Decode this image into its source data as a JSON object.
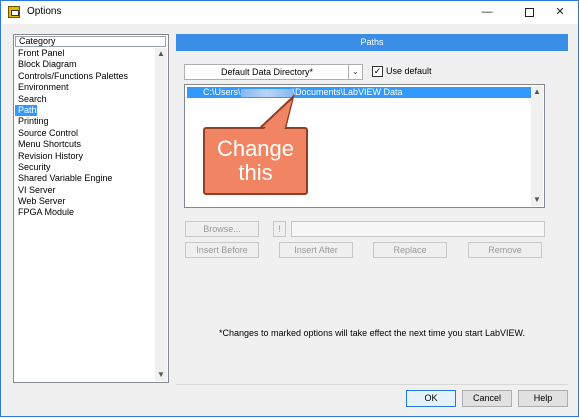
{
  "window": {
    "title": "Options",
    "minimize": "—",
    "maximize": "",
    "close": "✕"
  },
  "category": {
    "header": "Category",
    "items": [
      "Front Panel",
      "Block Diagram",
      "Controls/Functions Palettes",
      "Environment",
      "Search",
      "Paths",
      "Printing",
      "Source Control",
      "Menu Shortcuts",
      "Revision History",
      "Security",
      "Shared Variable Engine",
      "VI Server",
      "Web Server",
      "FPGA Module"
    ],
    "selected": "Paths"
  },
  "paths": {
    "header": "Paths",
    "dropdown_value": "Default Data Directory*",
    "use_default_label": "Use default",
    "use_default_checked": true,
    "path_prefix": "C:\\Users\\",
    "path_suffix": "\\Documents\\LabVIEW Data",
    "browse_label": "Browse...",
    "excl_label": "!",
    "insert_before_label": "Insert Before",
    "insert_after_label": "Insert After",
    "replace_label": "Replace",
    "remove_label": "Remove",
    "note": "*Changes to marked options will take effect the next time you start LabVIEW."
  },
  "callout": {
    "line1": "Change",
    "line2": "this"
  },
  "footer": {
    "ok_label": "OK",
    "cancel_label": "Cancel",
    "help_label": "Help"
  },
  "colors": {
    "accent": "#3a8ee6",
    "selection": "#3399ff",
    "callout_fill": "#f08463",
    "callout_border": "#8e3f27"
  }
}
